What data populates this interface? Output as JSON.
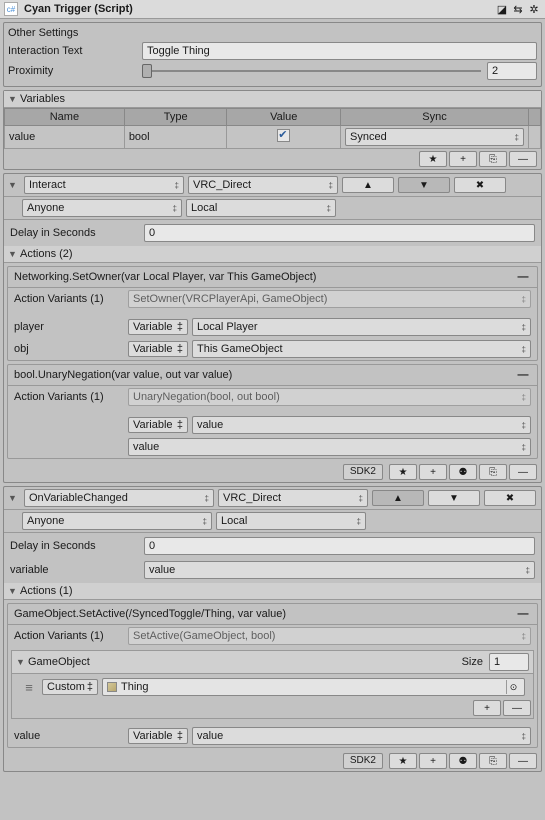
{
  "header": {
    "icon": "c#",
    "title": "Cyan Trigger (Script)"
  },
  "otherSettings": {
    "title": "Other Settings",
    "interactionTextLabel": "Interaction Text",
    "interactionText": "Toggle Thing",
    "proximityLabel": "Proximity",
    "proximity": "2"
  },
  "variables": {
    "title": "Variables",
    "headers": {
      "name": "Name",
      "type": "Type",
      "value": "Value",
      "sync": "Sync"
    },
    "row": {
      "name": "value",
      "type": "bool",
      "checked": true,
      "sync": "Synced"
    }
  },
  "event1": {
    "name": "Interact",
    "broadcast": "VRC_Direct",
    "who": "Anyone",
    "scope": "Local",
    "delayLabel": "Delay in Seconds",
    "delay": "0",
    "actionsTitle": "Actions (2)",
    "a1": {
      "title": "Networking.SetOwner(var Local Player, var This GameObject)",
      "variants": "Action Variants (1)",
      "variantSel": "SetOwner(VRCPlayerApi, GameObject)",
      "p1Label": "player",
      "p1Type": "Variable",
      "p1Val": "Local Player",
      "p2Label": "obj",
      "p2Type": "Variable",
      "p2Val": "This GameObject"
    },
    "a2": {
      "title": "bool.UnaryNegation(var value, out var value)",
      "variants": "Action Variants (1)",
      "variantSel": "UnaryNegation(bool, out bool)",
      "p1Type": "Variable",
      "p1Val": "value",
      "p2Val": "value"
    },
    "footerBadge": "SDK2"
  },
  "event2": {
    "name": "OnVariableChanged",
    "broadcast": "VRC_Direct",
    "who": "Anyone",
    "scope": "Local",
    "delayLabel": "Delay in Seconds",
    "delay": "0",
    "variableLabel": "variable",
    "variableVal": "value",
    "actionsTitle": "Actions (1)",
    "a1": {
      "title": "GameObject.SetActive(/SyncedToggle/Thing, var value)",
      "variants": "Action Variants (1)",
      "variantSel": "SetActive(GameObject, bool)",
      "goTitle": "GameObject",
      "sizeLabel": "Size",
      "size": "1",
      "custom": "Custom",
      "objName": "Thing",
      "valLabel": "value",
      "valType": "Variable",
      "valVal": "value"
    },
    "footerBadge": "SDK2"
  }
}
